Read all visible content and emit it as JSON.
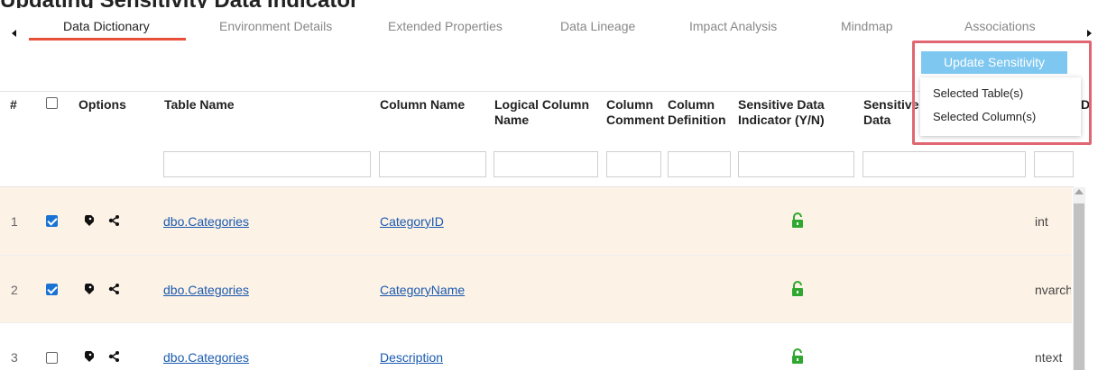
{
  "page": {
    "heading": "Updating Sensitivity Data Indicator"
  },
  "tabs": [
    {
      "label": "Data Dictionary",
      "active": true
    },
    {
      "label": "Environment Details",
      "active": false
    },
    {
      "label": "Extended Properties",
      "active": false
    },
    {
      "label": "Data Lineage",
      "active": false
    },
    {
      "label": "Impact Analysis",
      "active": false
    },
    {
      "label": "Mindmap",
      "active": false
    },
    {
      "label": "Associations",
      "active": false
    }
  ],
  "actions": {
    "update_sensitivity_label": "Update Sensitivity",
    "menu": [
      "Selected Table(s)",
      "Selected Column(s)"
    ]
  },
  "columns": {
    "num": "#",
    "options": "Options",
    "table_name": "Table Name",
    "column_name": "Column Name",
    "logical_column_name": "Logical Column Name",
    "column_comment": "Column Comment",
    "column_definition": "Column Definition",
    "sdi": "Sensitive Data Indicator (Y/N)",
    "sdi_class": "Sensitive Data Indicator (SDI) Classification",
    "datatype": "Datatype"
  },
  "rows": [
    {
      "num": "1",
      "checked": true,
      "table": "dbo.Categories",
      "column": "CategoryID",
      "datatype": "int"
    },
    {
      "num": "2",
      "checked": true,
      "table": "dbo.Categories",
      "column": "CategoryName",
      "datatype": "nvarchar"
    },
    {
      "num": "3",
      "checked": false,
      "table": "dbo.Categories",
      "column": "Description",
      "datatype": "ntext"
    }
  ],
  "icons": {
    "options": [
      "tag-icon",
      "share-icon"
    ],
    "sdi": "unlock-icon",
    "nav": [
      "scroll-left-icon",
      "scroll-right-icon"
    ]
  },
  "colors": {
    "active_tab_underline": "#e8503a",
    "update_button": "#7ec7f0",
    "highlight_box": "#e06671",
    "selected_row": "#fdf2e6",
    "lock": "#2fa82f",
    "link": "#1a5aaf",
    "checkbox_checked": "#1a73d4"
  }
}
